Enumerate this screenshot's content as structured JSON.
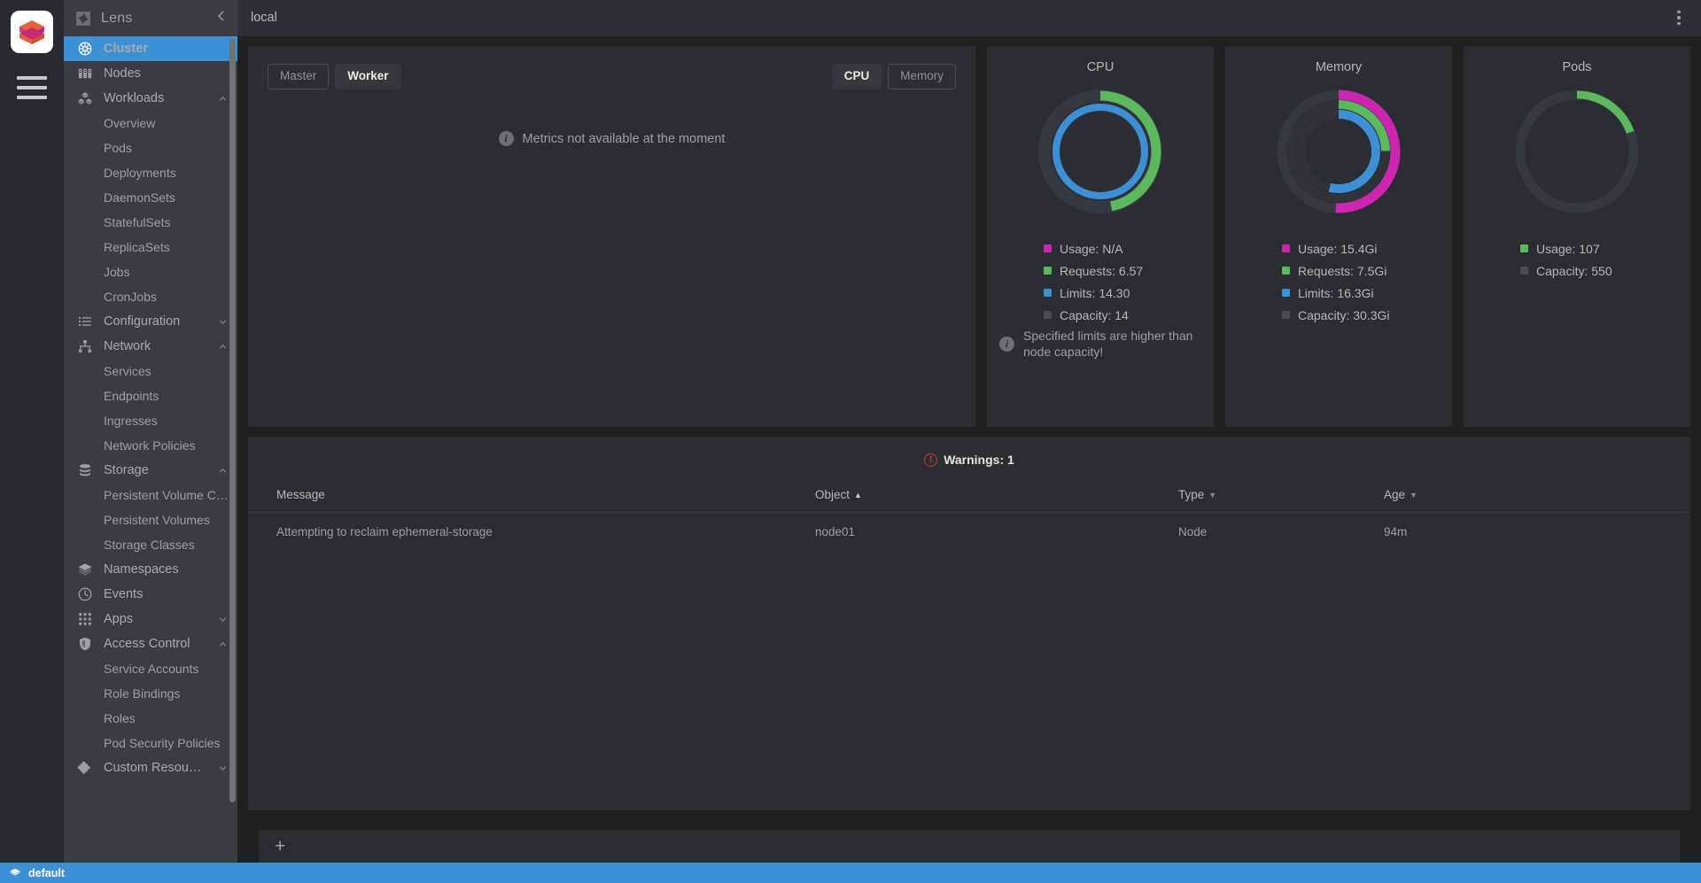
{
  "app": {
    "logo_icon": "lens-cube-logo",
    "menu_icon": "hamburger-menu-icon",
    "sidebar_title": "Lens",
    "collapse_icon": "chevron-left-icon",
    "lens_icon": "lens-aperture-icon"
  },
  "topbar": {
    "title": "local",
    "menu_icon": "kebab-menu-icon"
  },
  "sidebar": {
    "items": [
      {
        "label": "Cluster",
        "icon": "helm-wheel-icon",
        "level": 0,
        "active": true,
        "chevron": ""
      },
      {
        "label": "Nodes",
        "icon": "servers-icon",
        "level": 0,
        "active": false,
        "chevron": ""
      },
      {
        "label": "Workloads",
        "icon": "cubes-icon",
        "level": 0,
        "active": false,
        "chevron": "up"
      },
      {
        "label": "Overview",
        "icon": "",
        "level": 1,
        "active": false,
        "chevron": ""
      },
      {
        "label": "Pods",
        "icon": "",
        "level": 1,
        "active": false,
        "chevron": ""
      },
      {
        "label": "Deployments",
        "icon": "",
        "level": 1,
        "active": false,
        "chevron": ""
      },
      {
        "label": "DaemonSets",
        "icon": "",
        "level": 1,
        "active": false,
        "chevron": ""
      },
      {
        "label": "StatefulSets",
        "icon": "",
        "level": 1,
        "active": false,
        "chevron": ""
      },
      {
        "label": "ReplicaSets",
        "icon": "",
        "level": 1,
        "active": false,
        "chevron": ""
      },
      {
        "label": "Jobs",
        "icon": "",
        "level": 1,
        "active": false,
        "chevron": ""
      },
      {
        "label": "CronJobs",
        "icon": "",
        "level": 1,
        "active": false,
        "chevron": ""
      },
      {
        "label": "Configuration",
        "icon": "list-icon",
        "level": 0,
        "active": false,
        "chevron": "down"
      },
      {
        "label": "Network",
        "icon": "network-node-icon",
        "level": 0,
        "active": false,
        "chevron": "up"
      },
      {
        "label": "Services",
        "icon": "",
        "level": 1,
        "active": false,
        "chevron": ""
      },
      {
        "label": "Endpoints",
        "icon": "",
        "level": 1,
        "active": false,
        "chevron": ""
      },
      {
        "label": "Ingresses",
        "icon": "",
        "level": 1,
        "active": false,
        "chevron": ""
      },
      {
        "label": "Network Policies",
        "icon": "",
        "level": 1,
        "active": false,
        "chevron": ""
      },
      {
        "label": "Storage",
        "icon": "database-icon",
        "level": 0,
        "active": false,
        "chevron": "up"
      },
      {
        "label": "Persistent Volume C…",
        "icon": "",
        "level": 1,
        "active": false,
        "chevron": ""
      },
      {
        "label": "Persistent Volumes",
        "icon": "",
        "level": 1,
        "active": false,
        "chevron": ""
      },
      {
        "label": "Storage Classes",
        "icon": "",
        "level": 1,
        "active": false,
        "chevron": ""
      },
      {
        "label": "Namespaces",
        "icon": "layers-icon",
        "level": 0,
        "active": false,
        "chevron": ""
      },
      {
        "label": "Events",
        "icon": "clock-icon",
        "level": 0,
        "active": false,
        "chevron": ""
      },
      {
        "label": "Apps",
        "icon": "grid-dots-icon",
        "level": 0,
        "active": false,
        "chevron": "down"
      },
      {
        "label": "Access Control",
        "icon": "shield-icon",
        "level": 0,
        "active": false,
        "chevron": "up"
      },
      {
        "label": "Service Accounts",
        "icon": "",
        "level": 1,
        "active": false,
        "chevron": ""
      },
      {
        "label": "Role Bindings",
        "icon": "",
        "level": 1,
        "active": false,
        "chevron": ""
      },
      {
        "label": "Roles",
        "icon": "",
        "level": 1,
        "active": false,
        "chevron": ""
      },
      {
        "label": "Pod Security Policies",
        "icon": "",
        "level": 1,
        "active": false,
        "chevron": ""
      },
      {
        "label": "Custom Resou…",
        "icon": "puzzle-icon",
        "level": 0,
        "active": false,
        "chevron": "down"
      }
    ]
  },
  "metrics_panel": {
    "node_tabs": [
      {
        "label": "Master",
        "active": false
      },
      {
        "label": "Worker",
        "active": true
      }
    ],
    "resource_tabs": [
      {
        "label": "CPU",
        "active": true
      },
      {
        "label": "Memory",
        "active": false
      }
    ],
    "empty_message": "Metrics not available at the moment",
    "empty_icon": "info-icon"
  },
  "colors": {
    "usage": "#cc26b0",
    "requests": "#5cb85c",
    "limits": "#3d90d6",
    "capacity": "#4a4e53",
    "track": "#343840",
    "accent": "#3d90d6",
    "warning": "#cf3a3a"
  },
  "chart_data": [
    {
      "type": "pie",
      "title": "CPU",
      "legend_position": "bottom-left",
      "note": "Specified limits are higher than node capacity!",
      "note_icon": "info-icon",
      "slices": [
        {
          "name": "Usage",
          "label": "Usage: N/A",
          "value": null,
          "percent": 0,
          "color": "#cc26b0",
          "ring": 0
        },
        {
          "name": "Requests",
          "label": "Requests: 6.57",
          "value": 6.57,
          "percent": 46.9,
          "color": "#5cb85c",
          "ring": 1
        },
        {
          "name": "Limits",
          "label": "Limits: 14.30",
          "value": 14.3,
          "percent": 100,
          "color": "#3d90d6",
          "ring": 2
        },
        {
          "name": "Capacity",
          "label": "Capacity: 14",
          "value": 14,
          "percent": 100,
          "color": "#4a4e53",
          "ring": 3
        }
      ]
    },
    {
      "type": "pie",
      "title": "Memory",
      "legend_position": "bottom-left",
      "note": "",
      "note_icon": "",
      "slices": [
        {
          "name": "Usage",
          "label": "Usage: 15.4Gi",
          "value": 15.4,
          "percent": 50.8,
          "color": "#cc26b0",
          "ring": 0
        },
        {
          "name": "Requests",
          "label": "Requests: 7.5Gi",
          "value": 7.5,
          "percent": 24.8,
          "color": "#5cb85c",
          "ring": 1
        },
        {
          "name": "Limits",
          "label": "Limits: 16.3Gi",
          "value": 16.3,
          "percent": 53.8,
          "color": "#3d90d6",
          "ring": 2
        },
        {
          "name": "Capacity",
          "label": "Capacity: 30.3Gi",
          "value": 30.3,
          "percent": 100,
          "color": "#4a4e53",
          "ring": 3
        }
      ]
    },
    {
      "type": "pie",
      "title": "Pods",
      "legend_position": "bottom-left",
      "note": "",
      "note_icon": "",
      "slices": [
        {
          "name": "Usage",
          "label": "Usage: 107",
          "value": 107,
          "percent": 19.5,
          "color": "#5cb85c",
          "ring": 0
        },
        {
          "name": "Capacity",
          "label": "Capacity: 550",
          "value": 550,
          "percent": 100,
          "color": "#4a4e53",
          "ring": 3
        }
      ]
    }
  ],
  "warnings": {
    "title": "Warnings: 1",
    "icon": "warning-exclamation-icon",
    "columns": [
      {
        "label": "Message",
        "sort": "none"
      },
      {
        "label": "Object",
        "sort": "asc"
      },
      {
        "label": "Type",
        "sort": "desc"
      },
      {
        "label": "Age",
        "sort": "desc"
      }
    ],
    "rows": [
      {
        "message": "Attempting to reclaim ephemeral-storage",
        "object": "node01",
        "type": "Node",
        "age": "94m"
      }
    ]
  },
  "tabstrip": {
    "add_label": "+",
    "add_icon": "plus-icon"
  },
  "statusbar": {
    "icon": "layers-icon",
    "label": "default"
  }
}
